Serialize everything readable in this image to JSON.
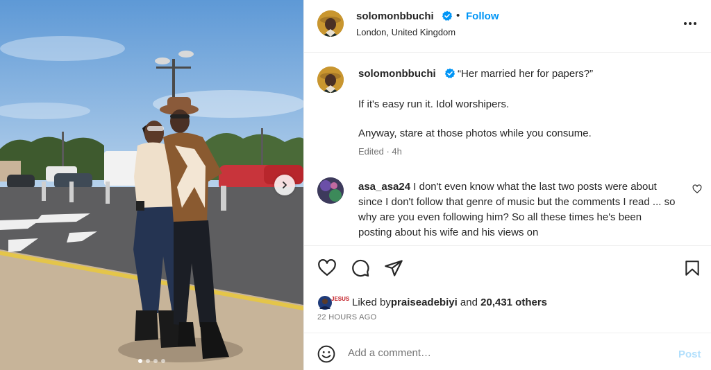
{
  "post": {
    "author": "solomonbbuchi",
    "follow_label": "Follow",
    "separator": "•",
    "location": "London, United Kingdom",
    "caption": {
      "username": "solomonbbuchi",
      "lines": [
        "“Her married her for papers?”",
        "If it's easy run it. Idol worshipers.",
        "Anyway, stare at those photos while you consume."
      ],
      "meta": "Edited · 4h"
    },
    "comment": {
      "username": "asa_asa24",
      "text": " I don't even know what the last two posts were about since I don't follow that genre of music but the comments I read ... so why are you even following him? So all these times he's been posting about his wife and his views on"
    },
    "likes": {
      "prefix": "Liked by ",
      "user": "praiseadebiyi",
      "middle": " and ",
      "count": "20,431 others",
      "badge_text": "JESUS"
    },
    "time": "22 HOURS AGO",
    "add_comment": {
      "placeholder": "Add a comment…",
      "post_label": "Post"
    },
    "carousel": {
      "slides": 4,
      "active": 1
    }
  },
  "colors": {
    "accent": "#0095f6",
    "verified": "#0095f6",
    "muted": "#737373",
    "post_disabled": "#b2dffc"
  },
  "icons": [
    "verified-badge-icon",
    "more-options-icon",
    "heart-icon",
    "comment-icon",
    "share-icon",
    "bookmark-icon",
    "emoji-icon",
    "chevron-right-icon"
  ]
}
